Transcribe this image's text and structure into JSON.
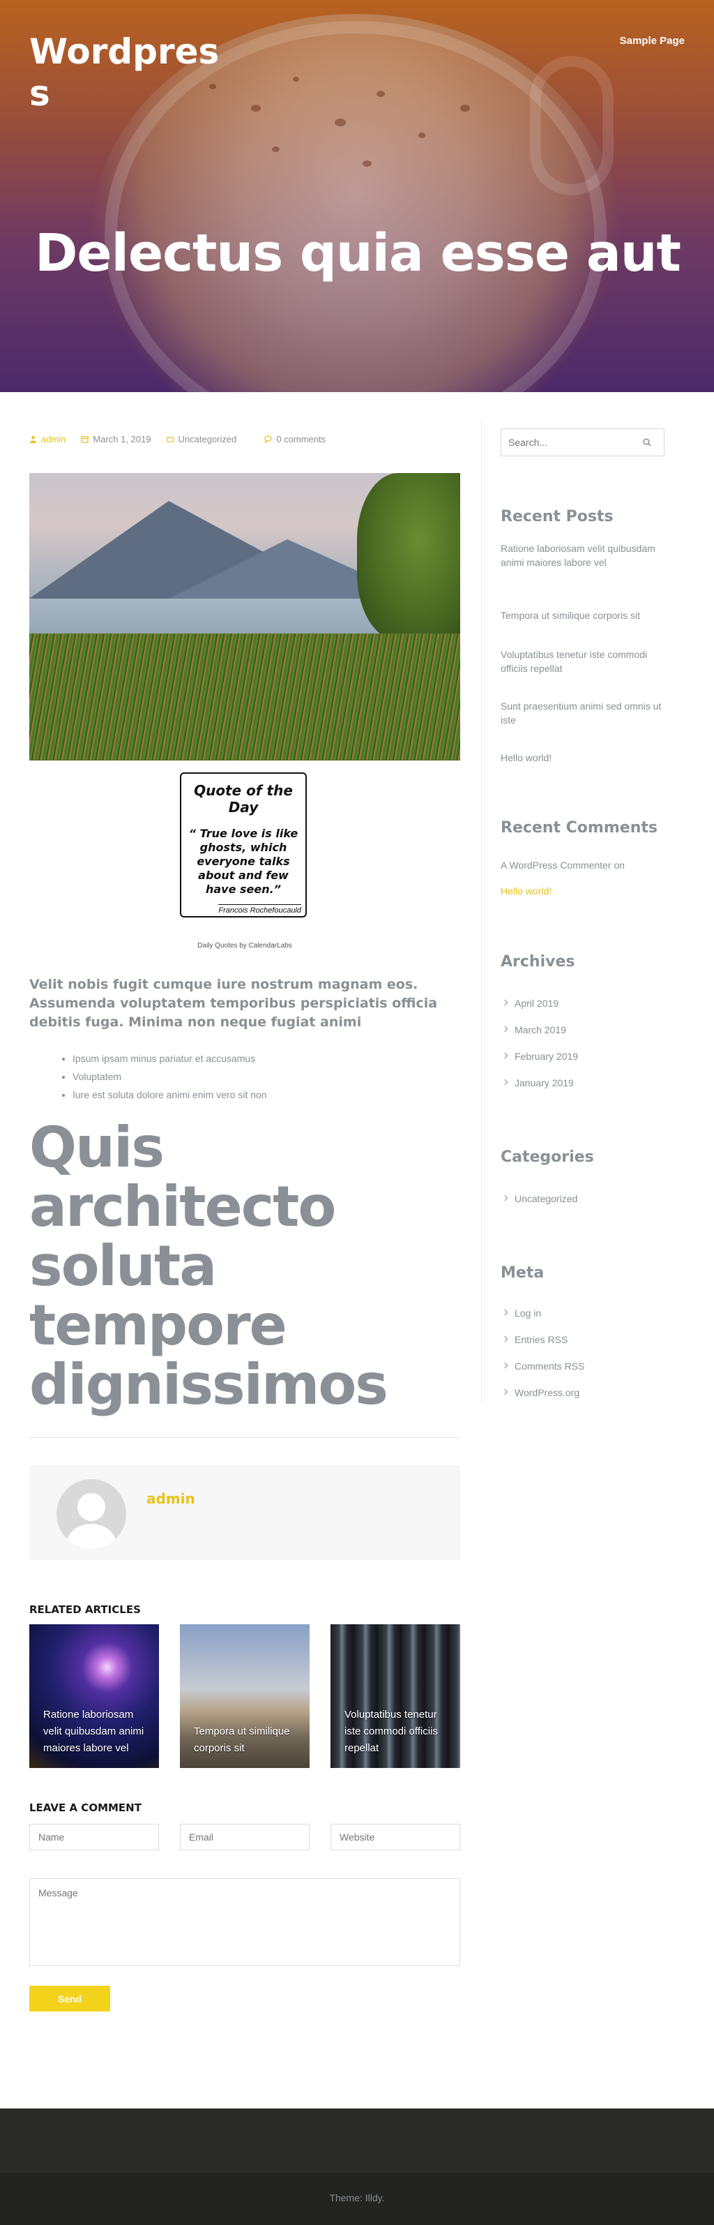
{
  "site": {
    "title": "Wordpress",
    "nav": [
      "Sample Page"
    ]
  },
  "hero": {
    "title": "Delectus quia esse aut"
  },
  "post": {
    "meta": {
      "author": "admin",
      "date": "March 1, 2019",
      "category": "Uncategorized",
      "comments": "0 comments"
    },
    "quote": {
      "title": "Quote of the Day",
      "text": "“ True love is like ghosts, which everyone talks about and few have seen.”",
      "author": "Francois Rochefoucauld",
      "caption": "Daily Quotes by CalendarLabs"
    },
    "lead": "Velit nobis fugit cumque iure nostrum magnam eos. Assumenda voluptatem temporibus perspiciatis officia debitis fuga. Minima non neque fugiat animi",
    "bullets": [
      "Ipsum ipsam minus pariatur et accusamus",
      "Voluptatem",
      "Iure est soluta dolore animi enim vero sit non"
    ],
    "big_heading": "Quis architecto soluta tempore dignissimos",
    "author_box_name": "admin"
  },
  "related": {
    "heading": "RELATED ARTICLES",
    "items": [
      "Ratione laboriosam velit quibusdam animi maiores labore vel",
      "Tempora ut similique corporis sit",
      "Voluptatibus tenetur iste commodi officiis repellat"
    ]
  },
  "comment_form": {
    "heading": "LEAVE A COMMENT",
    "name_placeholder": "Name",
    "email_placeholder": "Email",
    "website_placeholder": "Website",
    "message_placeholder": "Message",
    "send_label": "Send"
  },
  "sidebar": {
    "search_placeholder": "Search...",
    "recent_posts_title": "Recent Posts",
    "recent_posts": [
      "Ratione laboriosam velit quibusdam animi maiores labore vel",
      "Tempora ut similique corporis sit",
      "Voluptatibus tenetur iste commodi officiis repellat",
      "Sunt praesentium animi sed omnis ut iste",
      "Hello world!"
    ],
    "recent_comments_title": "Recent Comments",
    "recent_comment": {
      "commenter": "A WordPress Commenter",
      "on": "on",
      "post": "Hello world!"
    },
    "archives_title": "Archives",
    "archives": [
      "April 2019",
      "March 2019",
      "February 2019",
      "January 2019"
    ],
    "categories_title": "Categories",
    "categories": [
      "Uncategorized"
    ],
    "meta_title": "Meta",
    "meta_links": [
      "Log in",
      "Entries RSS",
      "Comments RSS",
      "WordPress.org"
    ]
  },
  "footer": {
    "credit": "Theme: Illdy."
  },
  "colors": {
    "accent": "#e8c31a",
    "button": "#f3d31b",
    "text_muted": "#8a8f93",
    "footer_top": "#2a2a28",
    "footer_bottom": "#232321"
  }
}
